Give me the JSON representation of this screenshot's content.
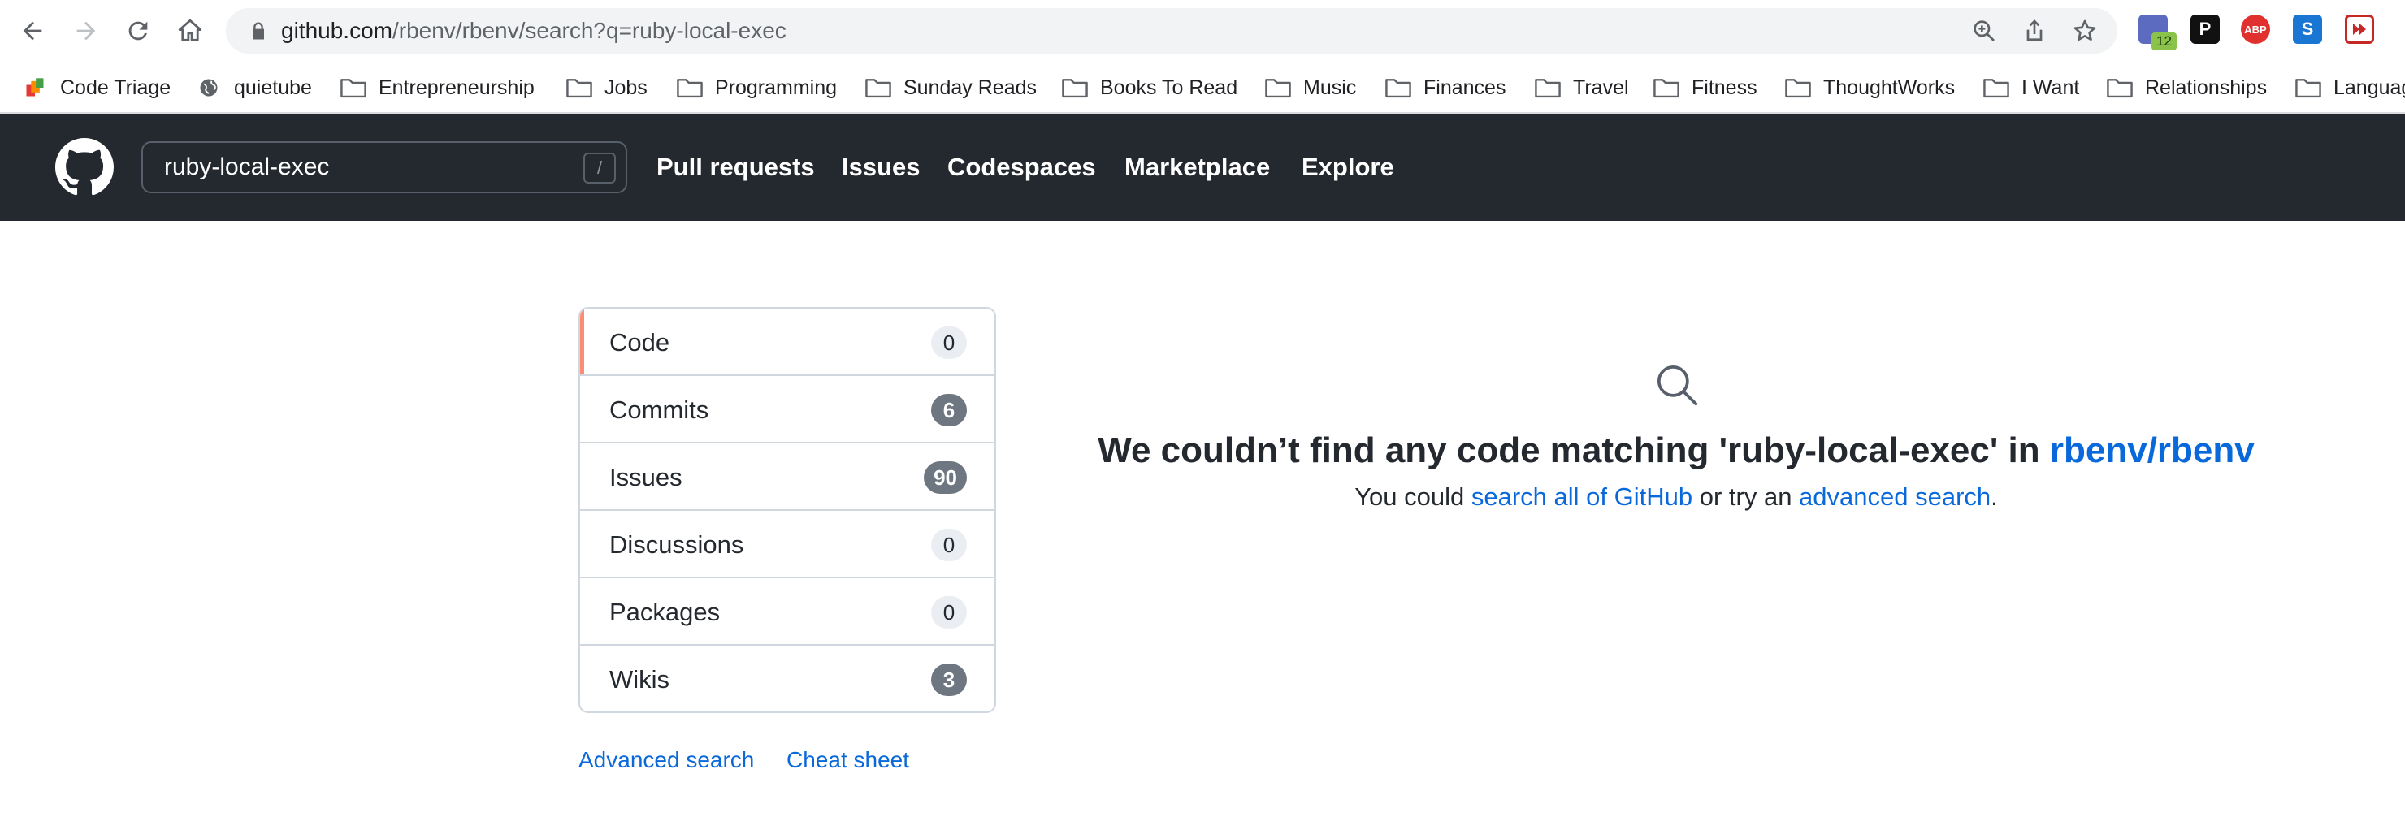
{
  "browser": {
    "url_host": "github.com",
    "url_path": "/rbenv/rbenv/search?q=ruby-local-exec",
    "extension_badge": "12",
    "extensions": [
      {
        "name": "calendar-extension",
        "label": ""
      },
      {
        "name": "p-extension",
        "label": "P"
      },
      {
        "name": "adblock-extension",
        "label": "ABP"
      },
      {
        "name": "s-extension",
        "label": "S"
      },
      {
        "name": "media-extension",
        "label": ""
      }
    ]
  },
  "bookmarks": [
    {
      "label": "Code Triage",
      "icon": "code-triage-icon"
    },
    {
      "label": "quietube",
      "icon": "globe-icon"
    },
    {
      "label": "Entrepreneurship",
      "icon": "folder-icon"
    },
    {
      "label": "Jobs",
      "icon": "folder-icon"
    },
    {
      "label": "Programming",
      "icon": "folder-icon"
    },
    {
      "label": "Sunday Reads",
      "icon": "folder-icon"
    },
    {
      "label": "Books To Read",
      "icon": "folder-icon"
    },
    {
      "label": "Music",
      "icon": "folder-icon"
    },
    {
      "label": "Finances",
      "icon": "folder-icon"
    },
    {
      "label": "Travel",
      "icon": "folder-icon"
    },
    {
      "label": "Fitness",
      "icon": "folder-icon"
    },
    {
      "label": "ThoughtWorks",
      "icon": "folder-icon"
    },
    {
      "label": "I Want",
      "icon": "folder-icon"
    },
    {
      "label": "Relationships",
      "icon": "folder-icon"
    },
    {
      "label": "Languag",
      "icon": "folder-icon"
    }
  ],
  "header": {
    "search_value": "ruby-local-exec",
    "slash_hint": "/",
    "nav": [
      "Pull requests",
      "Issues",
      "Codespaces",
      "Marketplace",
      "Explore"
    ]
  },
  "filters": [
    {
      "label": "Code",
      "count": "0",
      "selected": true
    },
    {
      "label": "Commits",
      "count": "6",
      "selected": false
    },
    {
      "label": "Issues",
      "count": "90",
      "selected": false
    },
    {
      "label": "Discussions",
      "count": "0",
      "selected": false
    },
    {
      "label": "Packages",
      "count": "0",
      "selected": false
    },
    {
      "label": "Wikis",
      "count": "3",
      "selected": false
    }
  ],
  "footer_links": {
    "advanced": "Advanced search",
    "cheat": "Cheat sheet"
  },
  "blankslate": {
    "title_prefix": "We couldn’t find any code matching 'ruby-local-exec' in ",
    "repo": "rbenv/rbenv",
    "sub_prefix": "You could ",
    "sub_link1": "search all of GitHub",
    "sub_middle": " or try an ",
    "sub_link2": "advanced search",
    "sub_suffix": "."
  },
  "colors": {
    "header_bg": "#24292f",
    "link": "#0969da",
    "selected_accent": "#fd8c73",
    "counter_dark": "#6e7781",
    "counter_light": "#eaeef2"
  }
}
